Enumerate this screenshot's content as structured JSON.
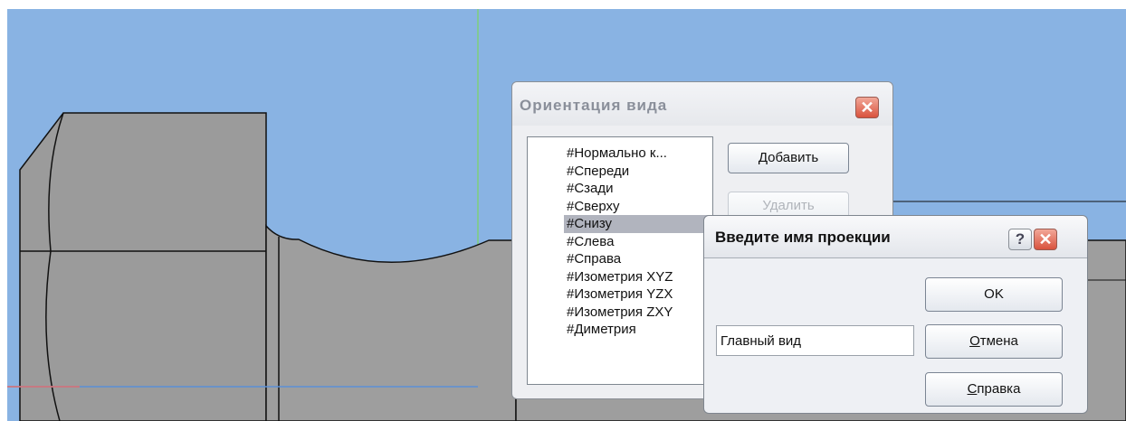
{
  "orientation_dialog": {
    "title": "Ориентация вида",
    "close_symbol": "✕",
    "views": [
      {
        "label": "#Нормально к...",
        "selected": false
      },
      {
        "label": "#Спереди",
        "selected": false
      },
      {
        "label": "#Сзади",
        "selected": false
      },
      {
        "label": "#Сверху",
        "selected": false
      },
      {
        "label": "#Снизу",
        "selected": true
      },
      {
        "label": "#Слева",
        "selected": false
      },
      {
        "label": "#Справа",
        "selected": false
      },
      {
        "label": "#Изометрия XYZ",
        "selected": false
      },
      {
        "label": "#Изометрия YZX",
        "selected": false
      },
      {
        "label": "#Изометрия ZXY",
        "selected": false
      },
      {
        "label": "#Диметрия",
        "selected": false
      }
    ],
    "add_button": {
      "first": "Д",
      "rest": "обавить"
    },
    "delete_button": {
      "label": "Удалить",
      "enabled": false
    }
  },
  "name_dialog": {
    "title": "Введите имя проекции",
    "help_symbol": "?",
    "close_symbol": "✕",
    "name_value": "Главный вид",
    "ok_label": "OK",
    "cancel_button": {
      "first": "О",
      "rest": "тмена"
    },
    "help_button": {
      "first": "С",
      "rest": "правка"
    }
  },
  "colors": {
    "viewport_bg": "#89b3e3",
    "part_face": "#9c9c9c",
    "dialog_body": "#eeeff2",
    "selection": "#b1b4be",
    "close_button": "#d9523e"
  }
}
